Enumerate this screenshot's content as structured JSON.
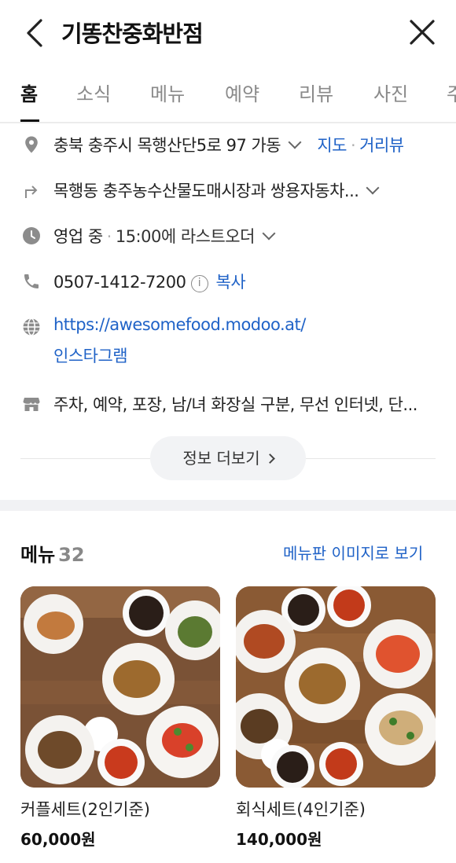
{
  "header": {
    "title": "기똥찬중화반점"
  },
  "tabs": [
    {
      "label": "홈"
    },
    {
      "label": "소식"
    },
    {
      "label": "메뉴"
    },
    {
      "label": "예약"
    },
    {
      "label": "리뷰"
    },
    {
      "label": "사진"
    },
    {
      "label": "주"
    }
  ],
  "info": {
    "address": "충북 충주시 목행산단5로 97 가동",
    "map_link": "지도",
    "roadview_link": "거리뷰",
    "directions": "목행동 충주농수산물도매시장과 쌍용자동차...",
    "status": "영업 중",
    "last_order": "15:00에 라스트오더",
    "phone": "0507-1412-7200",
    "copy_label": "복사",
    "website": "https://awesomefood.modoo.at/",
    "instagram": "인스타그램",
    "amenities": "주차, 예약, 포장, 남/녀 화장실 구분, 무선 인터넷, 단..."
  },
  "more_info_label": "정보 더보기",
  "menu": {
    "title": "메뉴",
    "count": "32",
    "board_link": "메뉴판 이미지로 보기",
    "items": [
      {
        "name": "커플세트(2인기준)",
        "price": "60,000원"
      },
      {
        "name": "회식세트(4인기준)",
        "price": "140,000원"
      }
    ]
  },
  "colors": {
    "link": "#1f62c7",
    "icon_gray": "#8c8c8c",
    "section_gap": "#f1f2f4"
  }
}
